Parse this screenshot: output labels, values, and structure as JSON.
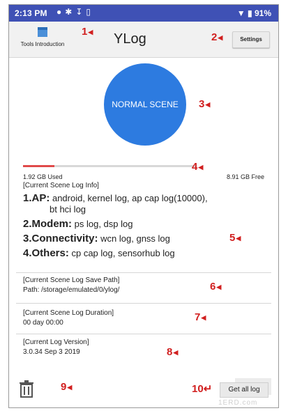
{
  "status_bar": {
    "time": "2:13 PM",
    "notification_icons": [
      "location-icon",
      "settings-icon",
      "download-icon",
      "message-icon"
    ],
    "battery": "91%"
  },
  "toolbar": {
    "tools_label": "Tools Introduction",
    "title": "YLog",
    "settings_label": "Settings"
  },
  "scene": {
    "label": "NORMAL SCENE",
    "color": "#2d7be0"
  },
  "storage": {
    "used": "1.92 GB Used",
    "free": "8.91 GB Free",
    "used_fraction": 0.18,
    "bar_color": "#e04a4a"
  },
  "log_info": {
    "heading": "[Current Scene Log Info]",
    "items": [
      {
        "label": "1.AP:",
        "content": "android, kernel log, ap cap log(10000),",
        "content2": "bt hci log"
      },
      {
        "label": "2.Modem:",
        "content": "ps log, dsp log"
      },
      {
        "label": "3.Connectivity:",
        "content": "wcn log, gnss log"
      },
      {
        "label": "4.Others:",
        "content": "cp cap log, sensorhub log"
      }
    ]
  },
  "save_path": {
    "heading": "[Current Scene Log Save Path]",
    "value": "Path: /storage/emulated/0/ylog/"
  },
  "duration": {
    "heading": "[Current Scene Log Duration]",
    "value": "00 day 00:00"
  },
  "version": {
    "heading": "[Current Log Version]",
    "value": "3.0.34 Sep  3 2019"
  },
  "bottom": {
    "get_all_label": "Get all log",
    "watermark": "1ERD.com"
  },
  "markers": [
    "1",
    "2",
    "3",
    "4",
    "5",
    "6",
    "7",
    "8",
    "9",
    "10"
  ],
  "marker_color": "#d11f1f"
}
